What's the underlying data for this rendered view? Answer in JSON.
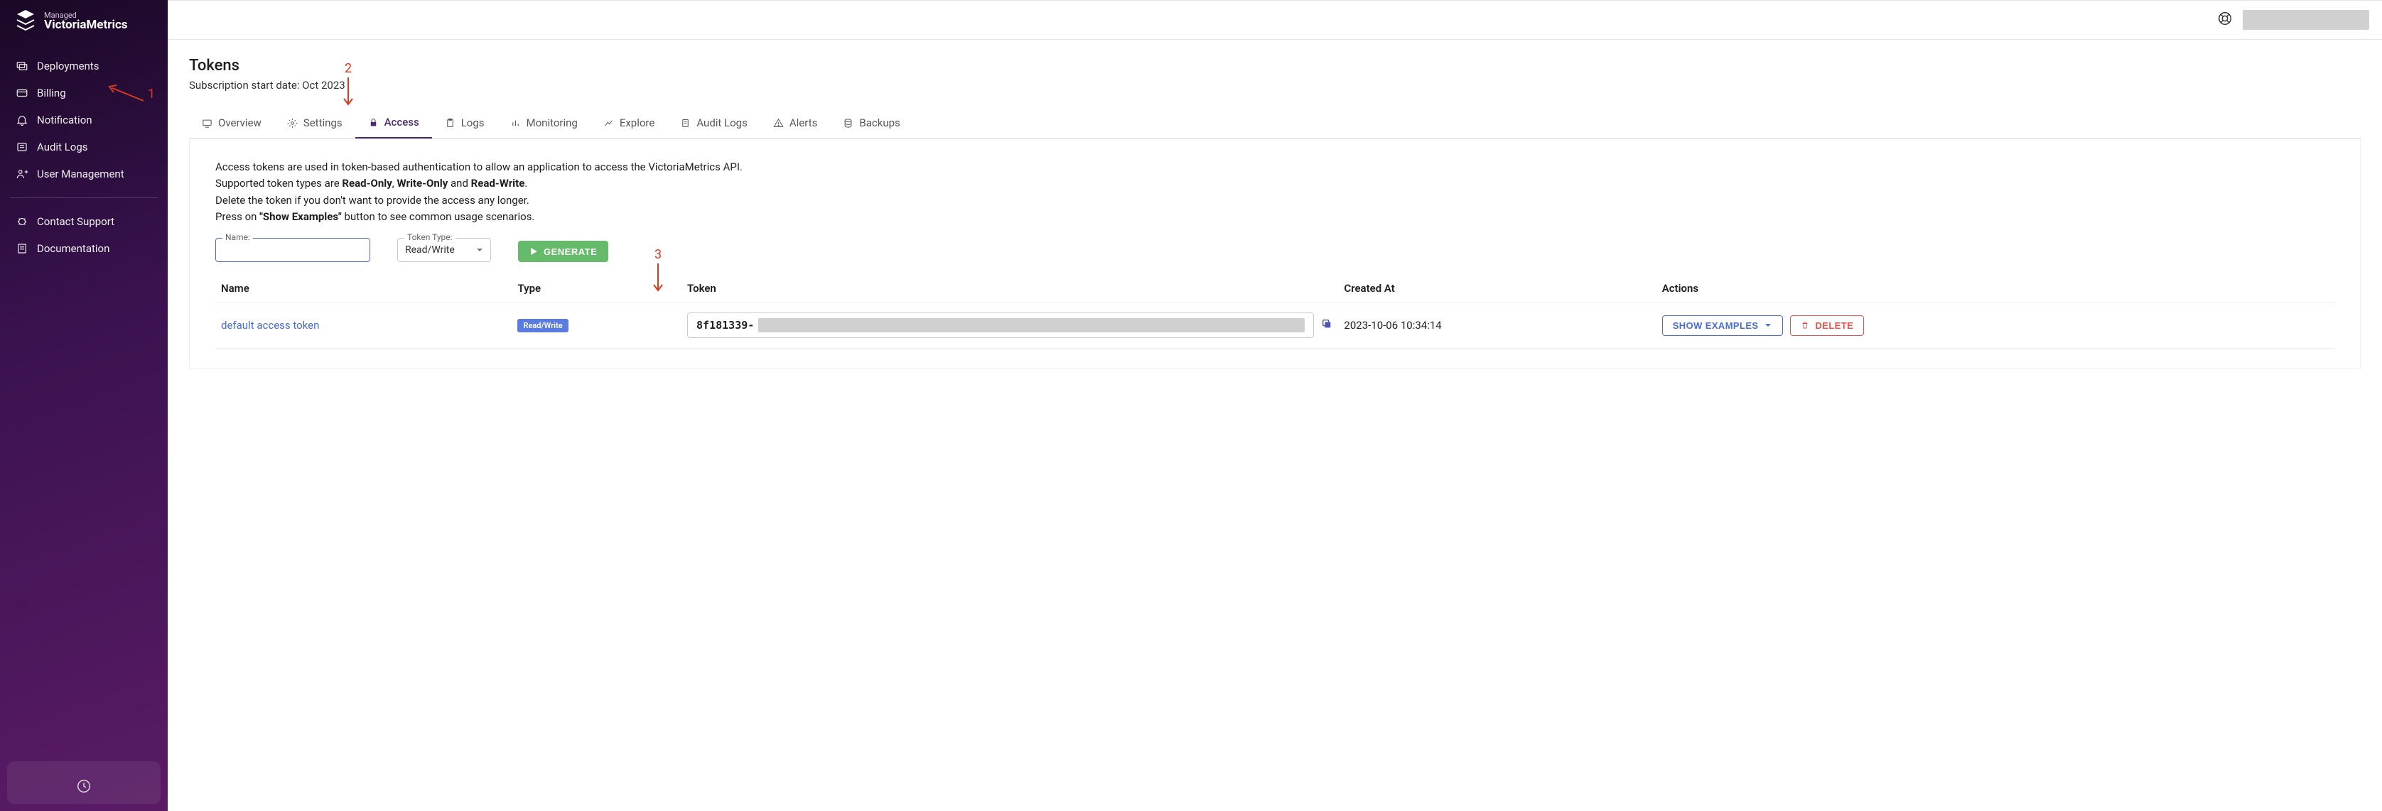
{
  "brand": {
    "small": "Managed",
    "big": "VictoriaMetrics"
  },
  "sidebar": {
    "items": [
      {
        "label": "Deployments"
      },
      {
        "label": "Billing"
      },
      {
        "label": "Notification"
      },
      {
        "label": "Audit Logs"
      },
      {
        "label": "User Management"
      }
    ],
    "secondary": [
      {
        "label": "Contact Support"
      },
      {
        "label": "Documentation"
      }
    ]
  },
  "page": {
    "title": "Tokens",
    "subtitle": "Subscription start date: Oct 2023"
  },
  "tabs": [
    {
      "label": "Overview"
    },
    {
      "label": "Settings"
    },
    {
      "label": "Access"
    },
    {
      "label": "Logs"
    },
    {
      "label": "Monitoring"
    },
    {
      "label": "Explore"
    },
    {
      "label": "Audit Logs"
    },
    {
      "label": "Alerts"
    },
    {
      "label": "Backups"
    }
  ],
  "desc": {
    "line1a": "Access tokens are used in token-based authentication to allow an application to access the VictoriaMetrics API.",
    "line2a": "Supported token types are ",
    "ro": "Read-Only",
    "comma": ", ",
    "wo": "Write-Only",
    "and": " and ",
    "rw": "Read-Write",
    "period": ".",
    "line3": "Delete the token if you don't want to provide the access any longer.",
    "line4a": "Press on ",
    "show": "\"Show Examples\"",
    "line4b": " button to see common usage scenarios."
  },
  "form": {
    "name_label": "Name:",
    "type_label": "Token Type:",
    "type_value": "Read/Write",
    "generate": "GENERATE"
  },
  "table": {
    "headers": {
      "name": "Name",
      "type": "Type",
      "token": "Token",
      "created": "Created At",
      "actions": "Actions"
    },
    "row": {
      "name": "default access token",
      "type": "Read/Write",
      "token_prefix": "8f181339-",
      "created": "2023-10-06 10:34:14",
      "show": "SHOW EXAMPLES",
      "delete": "DELETE"
    }
  },
  "annotations": {
    "a1": "1",
    "a2": "2",
    "a3": "3"
  }
}
